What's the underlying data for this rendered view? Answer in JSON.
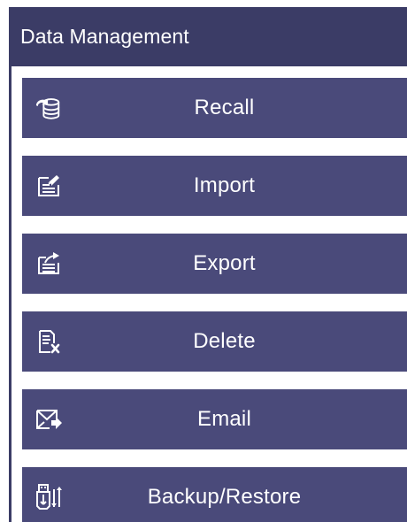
{
  "header": {
    "title": "Data Management"
  },
  "menu": [
    {
      "id": "recall",
      "label": "Recall",
      "icon": "database-recall-icon"
    },
    {
      "id": "import",
      "label": "Import",
      "icon": "import-document-icon"
    },
    {
      "id": "export",
      "label": "Export",
      "icon": "export-document-icon"
    },
    {
      "id": "delete",
      "label": "Delete",
      "icon": "delete-document-icon"
    },
    {
      "id": "email",
      "label": "Email",
      "icon": "email-send-icon"
    },
    {
      "id": "backup",
      "label": "Backup/Restore",
      "icon": "usb-transfer-icon"
    }
  ],
  "colors": {
    "header_bg": "#3b3c66",
    "button_bg": "#4a4a7a",
    "text": "#ffffff"
  }
}
